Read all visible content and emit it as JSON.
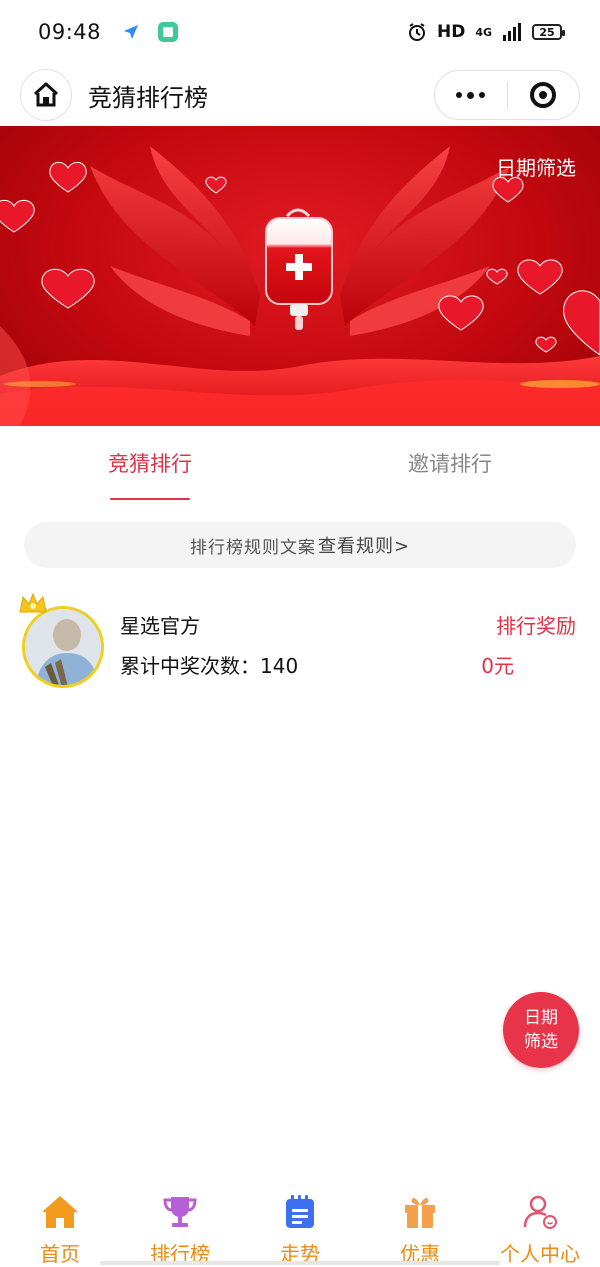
{
  "status_bar": {
    "time": "09:48",
    "network": "HD",
    "signal_label": "4G",
    "battery": "25"
  },
  "title_bar": {
    "title": "竞猜排行榜"
  },
  "banner": {
    "date_filter_label": "日期筛选"
  },
  "tabs": [
    {
      "label": "竞猜排行",
      "active": true
    },
    {
      "label": "邀请排行",
      "active": false
    }
  ],
  "rules": {
    "text": "排行榜规则文案",
    "link": "查看规则>"
  },
  "ranking": [
    {
      "name": "星选官方",
      "count_label": "累计中奖次数：140",
      "reward_label": "排行奖励",
      "reward_value": "0元"
    }
  ],
  "float_filter": {
    "line1": "日期",
    "line2": "筛选"
  },
  "bottom_nav": [
    {
      "label": "首页",
      "icon": "home-icon"
    },
    {
      "label": "排行榜",
      "icon": "trophy-icon"
    },
    {
      "label": "走势",
      "icon": "notepad-icon"
    },
    {
      "label": "优惠",
      "icon": "gift-icon"
    },
    {
      "label": "个人中心",
      "icon": "user-icon"
    }
  ],
  "colors": {
    "accent": "#e33146",
    "nav_label": "#ee8a10",
    "banner_red": "#c3080f"
  }
}
